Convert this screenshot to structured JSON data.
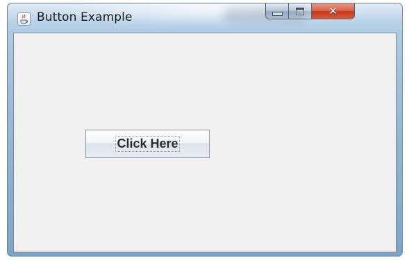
{
  "window": {
    "title": "Button Example",
    "app_icon": "java-cup-icon",
    "caption_buttons": {
      "minimize_icon": "minimize-icon",
      "maximize_icon": "maximize-icon",
      "close_icon": "close-icon",
      "close_glyph": "✕"
    }
  },
  "content": {
    "button_label": "Click Here"
  },
  "colors": {
    "frame": "#a9c6e1",
    "content_background": "#f0f0f0",
    "close_button": "#c2391f"
  }
}
